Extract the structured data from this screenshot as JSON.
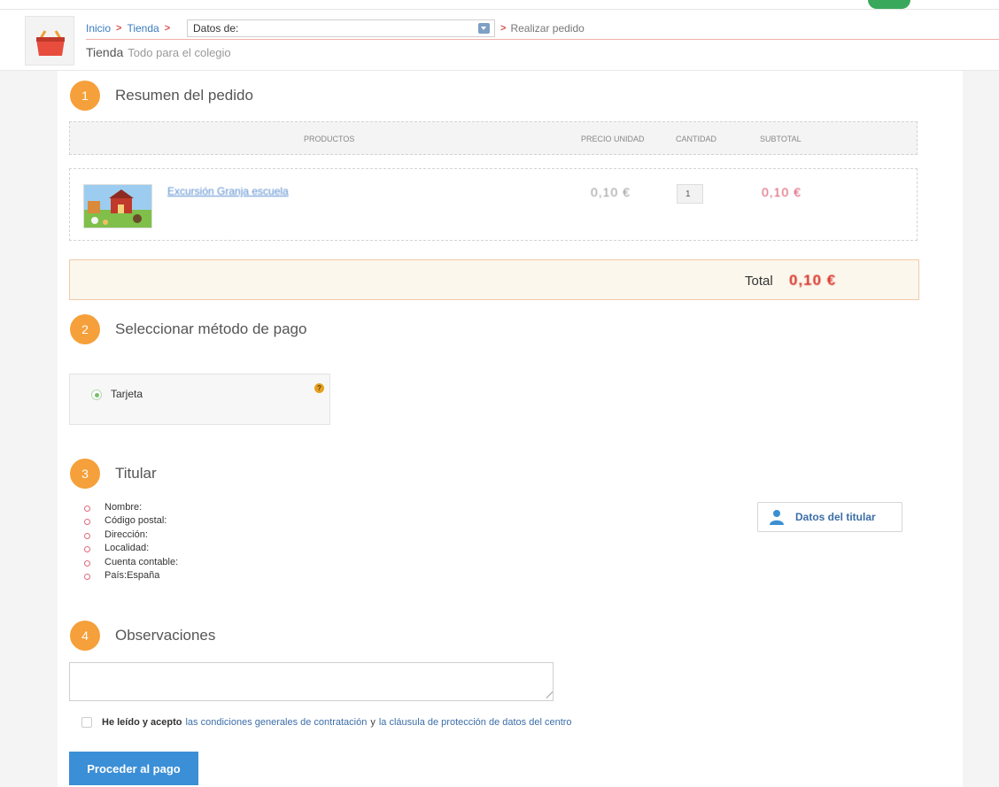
{
  "header": {
    "breadcrumb": {
      "home": "Inicio",
      "shop": "Tienda",
      "select_value": "Datos de:",
      "current": "Realizar pedido"
    },
    "store_title": "Tienda",
    "store_subtitle": "Todo para el colegio"
  },
  "steps": [
    {
      "number": "1",
      "title": "Resumen del pedido"
    },
    {
      "number": "2",
      "title": "Seleccionar método de pago"
    },
    {
      "number": "3",
      "title": "Titular"
    },
    {
      "number": "4",
      "title": "Observaciones"
    }
  ],
  "order": {
    "columns": {
      "products": "PRODUCTOS",
      "unit_price": "PRECIO UNIDAD",
      "quantity": "CANTIDAD",
      "subtotal": "SUBTOTAL"
    },
    "items": [
      {
        "name": "Excursión Granja escuela",
        "unit_price": "0,10 €",
        "quantity": "1",
        "subtotal": "0,10 €"
      }
    ],
    "total_label": "Total",
    "total_value": "0,10 €"
  },
  "payment": {
    "method_label": "Tarjeta",
    "help_icon": "?"
  },
  "holder": {
    "fields": [
      "Nombre:",
      "Código postal:",
      "Dirección:",
      "Localidad:",
      "Cuenta contable:",
      "País:España"
    ],
    "button_label": "Datos del titular"
  },
  "terms": {
    "prefix": "He leído y acepto",
    "link1": "las condiciones generales de contratación",
    "connector": "y",
    "link2": "la cláusula de protección de datos del centro"
  },
  "submit_label": "Proceder al pago",
  "colors": {
    "accent_orange": "#f5a03a",
    "link_blue": "#3c6ea8",
    "primary_button": "#3b8fd6",
    "price_red": "#d9342b"
  }
}
